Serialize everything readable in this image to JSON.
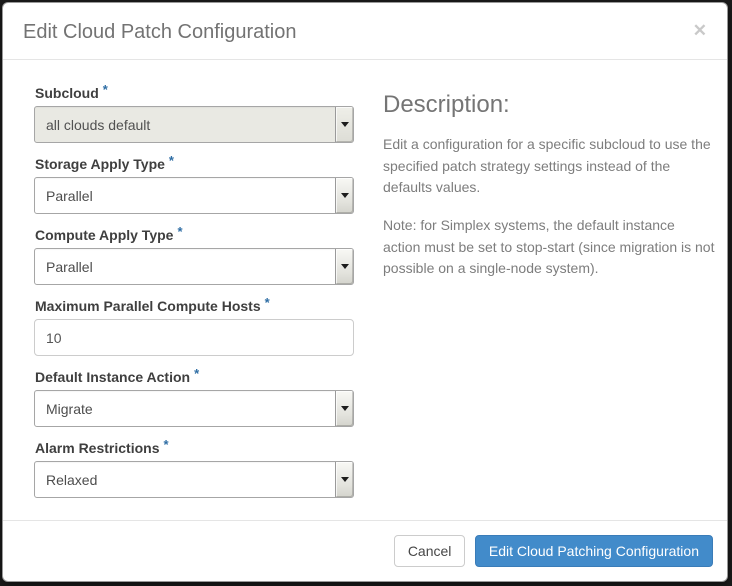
{
  "modal": {
    "title": "Edit Cloud Patch Configuration",
    "close_glyph": "✕"
  },
  "form": {
    "required_mark": "*",
    "fields": [
      {
        "label": "Subcloud",
        "required": true,
        "type": "select",
        "value": "all clouds default",
        "disabled": true
      },
      {
        "label": "Storage Apply Type",
        "required": true,
        "type": "select",
        "value": "Parallel",
        "disabled": false
      },
      {
        "label": "Compute Apply Type",
        "required": true,
        "type": "select",
        "value": "Parallel",
        "disabled": false
      },
      {
        "label": "Maximum Parallel Compute Hosts",
        "required": true,
        "type": "text",
        "value": "10",
        "disabled": false
      },
      {
        "label": "Default Instance Action",
        "required": true,
        "type": "select",
        "value": "Migrate",
        "disabled": false
      },
      {
        "label": "Alarm Restrictions",
        "required": true,
        "type": "select",
        "value": "Relaxed",
        "disabled": false
      }
    ]
  },
  "description": {
    "heading": "Description:",
    "paragraphs": [
      "Edit a configuration for a specific subcloud to use the specified patch strategy settings instead of the defaults values.",
      "Note: for Simplex systems, the default instance action must be set to stop-start (since migration is not possible on a single-node system)."
    ]
  },
  "footer": {
    "cancel_label": "Cancel",
    "submit_label": "Edit Cloud Patching Configuration"
  },
  "colors": {
    "primary_button": "#428bca",
    "required_asterisk": "#2e6da4",
    "title_text": "#737373",
    "disabled_field_bg": "#e9e9e3"
  }
}
